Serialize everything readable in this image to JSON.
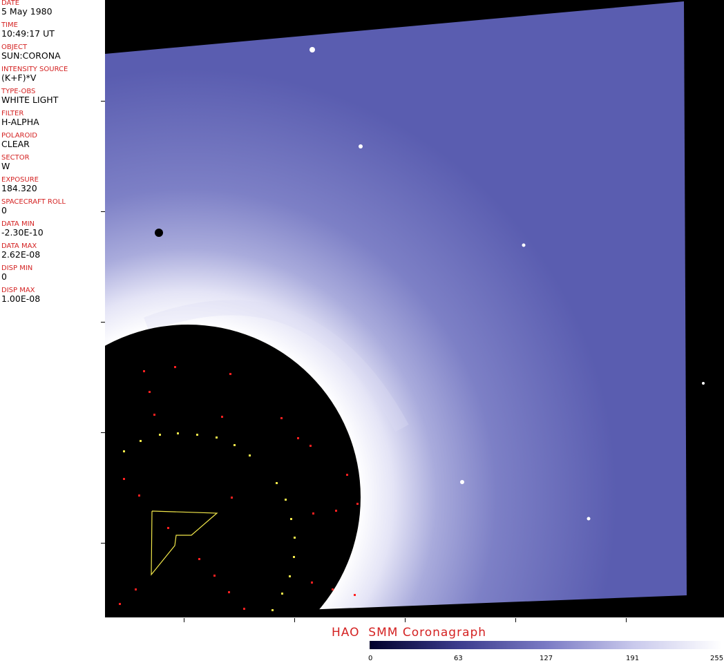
{
  "metadata": [
    {
      "label": "DATE",
      "value": "5 May 1980"
    },
    {
      "label": "TIME",
      "value": "10:49:17 UT"
    },
    {
      "label": "OBJECT",
      "value": "SUN:CORONA"
    },
    {
      "label": "INTENSITY SOURCE",
      "value": "(K+F)*V"
    },
    {
      "label": "TYPE-OBS",
      "value": "WHITE LIGHT"
    },
    {
      "label": "FILTER",
      "value": "H-ALPHA"
    },
    {
      "label": "POLAROID",
      "value": "CLEAR"
    },
    {
      "label": "SECTOR",
      "value": "W"
    },
    {
      "label": "EXPOSURE",
      "value": "184.320"
    },
    {
      "label": "SPACECRAFT ROLL",
      "value": "0"
    },
    {
      "label": "DATA MIN",
      "value": "-2.30E-10"
    },
    {
      "label": "DATA MAX",
      "value": "2.62E-08"
    },
    {
      "label": "DISP MIN",
      "value": "0"
    },
    {
      "label": "DISP MAX",
      "value": "1.00E-08"
    }
  ],
  "title": "HAO  SMM Coronagraph",
  "colorbar": {
    "ticks": [
      "0",
      "63",
      "127",
      "191",
      "255"
    ],
    "colors": [
      "#00002a",
      "#3b3b8c",
      "#7a7ac4",
      "#c9c9ec",
      "#ffffff"
    ]
  },
  "colors": {
    "label": "#d42222",
    "corona": "#5a5db0",
    "occulter": "#000000",
    "overlay_yellow": "#f2e84a",
    "overlay_red": "#ff2020"
  }
}
